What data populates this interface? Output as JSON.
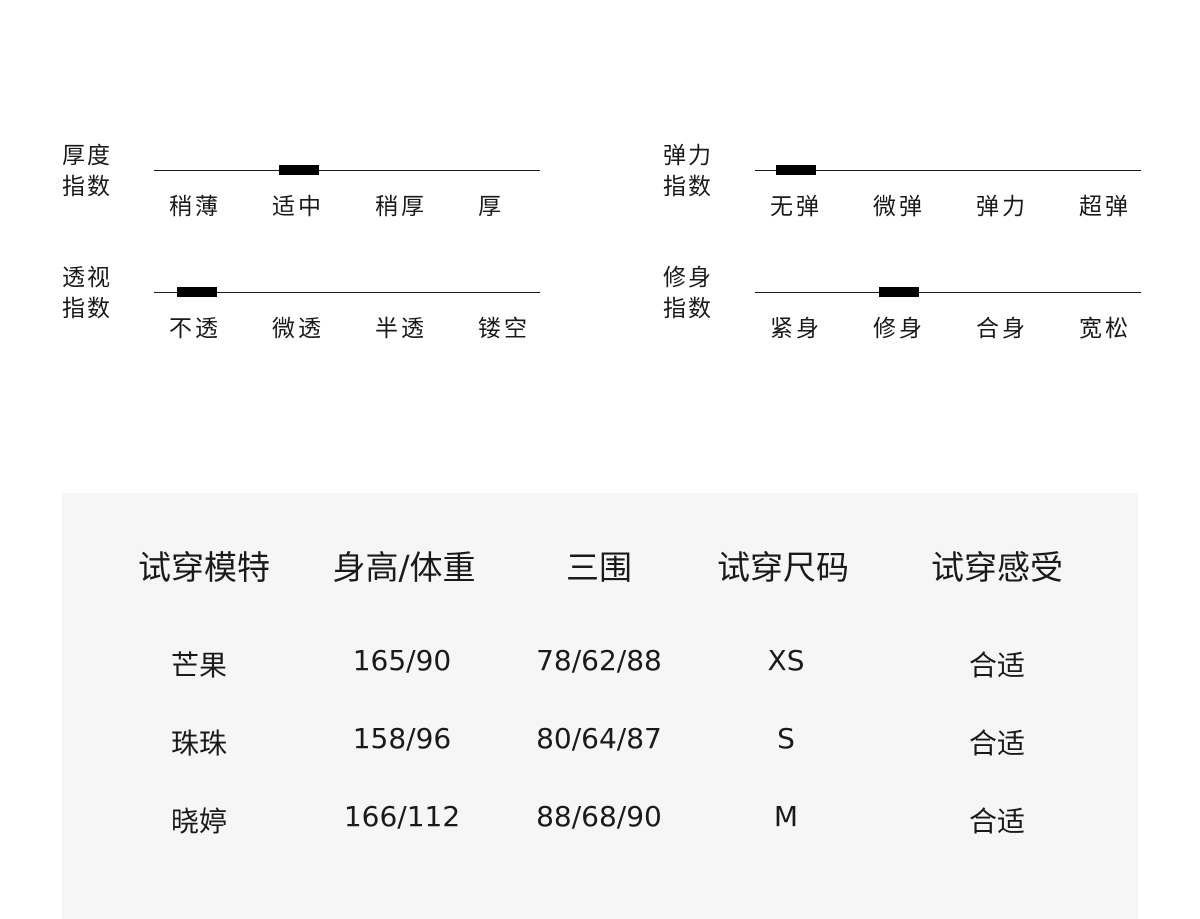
{
  "indices": [
    {
      "id": "thickness",
      "label": [
        "厚度",
        "指数"
      ],
      "options": [
        "稍薄",
        "适中",
        "稍厚",
        "厚"
      ],
      "selected": 1
    },
    {
      "id": "elasticity",
      "label": [
        "弹力",
        "指数"
      ],
      "options": [
        "无弹",
        "微弹",
        "弹力",
        "超弹"
      ],
      "selected": 0
    },
    {
      "id": "transparency",
      "label": [
        "透视",
        "指数"
      ],
      "options": [
        "不透",
        "微透",
        "半透",
        "镂空"
      ],
      "selected": 0
    },
    {
      "id": "fit",
      "label": [
        "修身",
        "指数"
      ],
      "options": [
        "紧身",
        "修身",
        "合身",
        "宽松"
      ],
      "selected": 1
    }
  ],
  "table": {
    "headers": [
      "试穿模特",
      "身高/体重",
      "三围",
      "试穿尺码",
      "试穿感受"
    ],
    "rows": [
      [
        "芒果",
        "165/90",
        "78/62/88",
        "XS",
        "合适"
      ],
      [
        "珠珠",
        "158/96",
        "80/64/87",
        "S",
        "合适"
      ],
      [
        "晓婷",
        "166/112",
        "88/68/90",
        "M",
        "合适"
      ]
    ]
  }
}
